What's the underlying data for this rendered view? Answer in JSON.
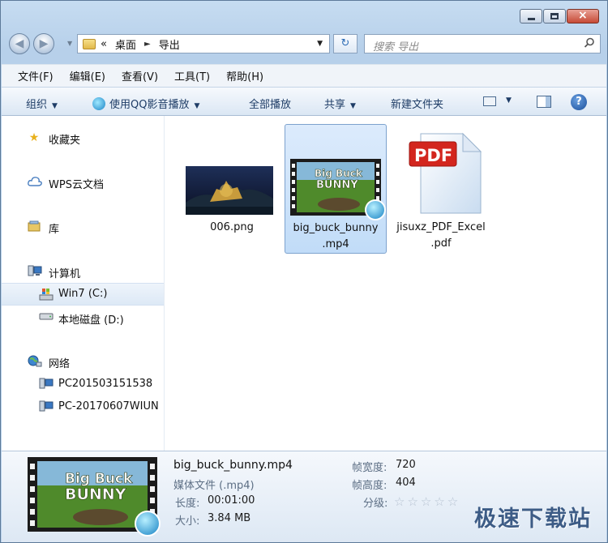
{
  "window": {
    "close_glyph": "×"
  },
  "nav": {
    "back_icon": "arrow-left-icon",
    "forward_icon": "arrow-right-icon",
    "breadcrumb_prefix": "«",
    "breadcrumb": [
      "桌面",
      "导出"
    ],
    "crumb_sep": "►",
    "refresh_glyph": "↻",
    "search_placeholder": "搜索 导出",
    "search_glyph": "⌕"
  },
  "menu": [
    "文件(F)",
    "编辑(E)",
    "查看(V)",
    "工具(T)",
    "帮助(H)"
  ],
  "toolbar": {
    "organize": "组织",
    "play_qq": "使用QQ影音播放",
    "play_all": "全部播放",
    "share": "共享",
    "new_folder": "新建文件夹",
    "help_glyph": "?",
    "caret": "▼"
  },
  "sidebar": {
    "favorites": "收藏夹",
    "wps": "WPS云文档",
    "library": "库",
    "computer": "计算机",
    "drive_c": "Win7 (C:)",
    "drive_d": "本地磁盘 (D:)",
    "network": "网络",
    "pc1": "PC201503151538",
    "pc2": "PC-20170607WIUN"
  },
  "files": [
    {
      "name": "006.png"
    },
    {
      "name_l1": "big_buck_bunny",
      "name_l2": ".mp4",
      "thumb_title_1": "Big Buck",
      "thumb_title_2": "BUNNY"
    },
    {
      "name_l1": "jisuxz_PDF_Excel",
      "name_l2": ".pdf",
      "badge": "PDF"
    }
  ],
  "details": {
    "filename": "big_buck_bunny.mp4",
    "type": "媒体文件 (.mp4)",
    "length_label": "长度:",
    "length": "00:01:00",
    "size_label": "大小:",
    "size": "3.84 MB",
    "width_label": "帧宽度:",
    "width": "720",
    "height_label": "帧高度:",
    "height": "404",
    "rating_label": "分级:",
    "rating_stars": "☆☆☆☆☆",
    "thumb_title_1": "Big Buck",
    "thumb_title_2": "BUNNY"
  },
  "watermark": "极速下载站"
}
